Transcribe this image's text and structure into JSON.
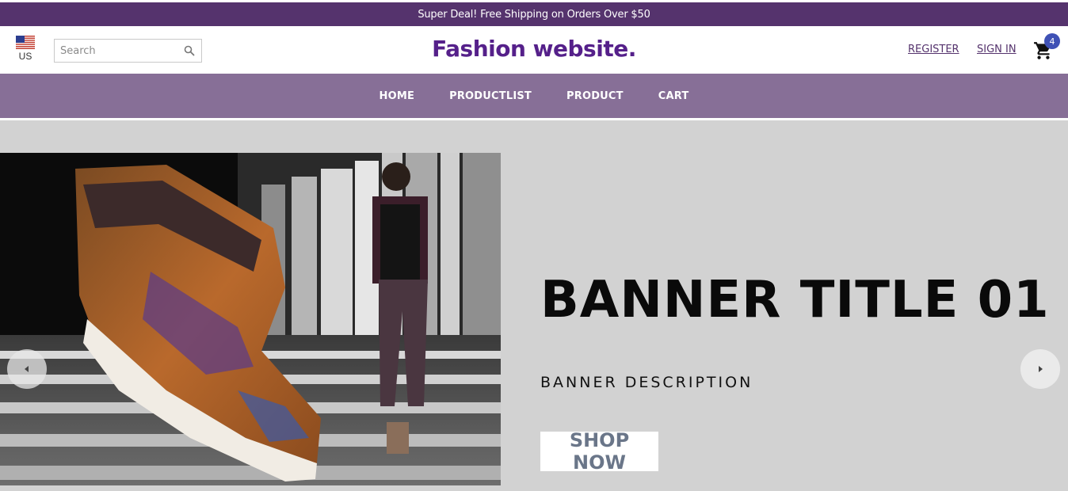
{
  "announcement": {
    "text": "Super Deal! Free Shipping on Orders Over $50"
  },
  "header": {
    "locale": {
      "label": "US",
      "icon": "us-flag-icon"
    },
    "search": {
      "placeholder": "Search",
      "value": "",
      "icon": "search-icon"
    },
    "logo": "Fashion website.",
    "register_label": "REGISTER",
    "signin_label": "SIGN IN",
    "cart": {
      "icon": "cart-icon",
      "count": "4"
    }
  },
  "nav": {
    "items": [
      {
        "label": "HOME"
      },
      {
        "label": "PRODUCTLIST"
      },
      {
        "label": "PRODUCT"
      },
      {
        "label": "CART"
      }
    ]
  },
  "hero": {
    "title": "BANNER TITLE 01",
    "description": "BANNER DESCRIPTION",
    "cta_label": "SHOP NOW",
    "image": "sneaker-and-model-photo",
    "prev_icon": "chevron-left-icon",
    "next_icon": "chevron-right-icon"
  },
  "colors": {
    "announcement_bg": "#55336d",
    "nav_bg": "#876f97",
    "brand": "#55208a",
    "hero_bg": "#d2d2d2",
    "badge": "#3f51b5"
  }
}
